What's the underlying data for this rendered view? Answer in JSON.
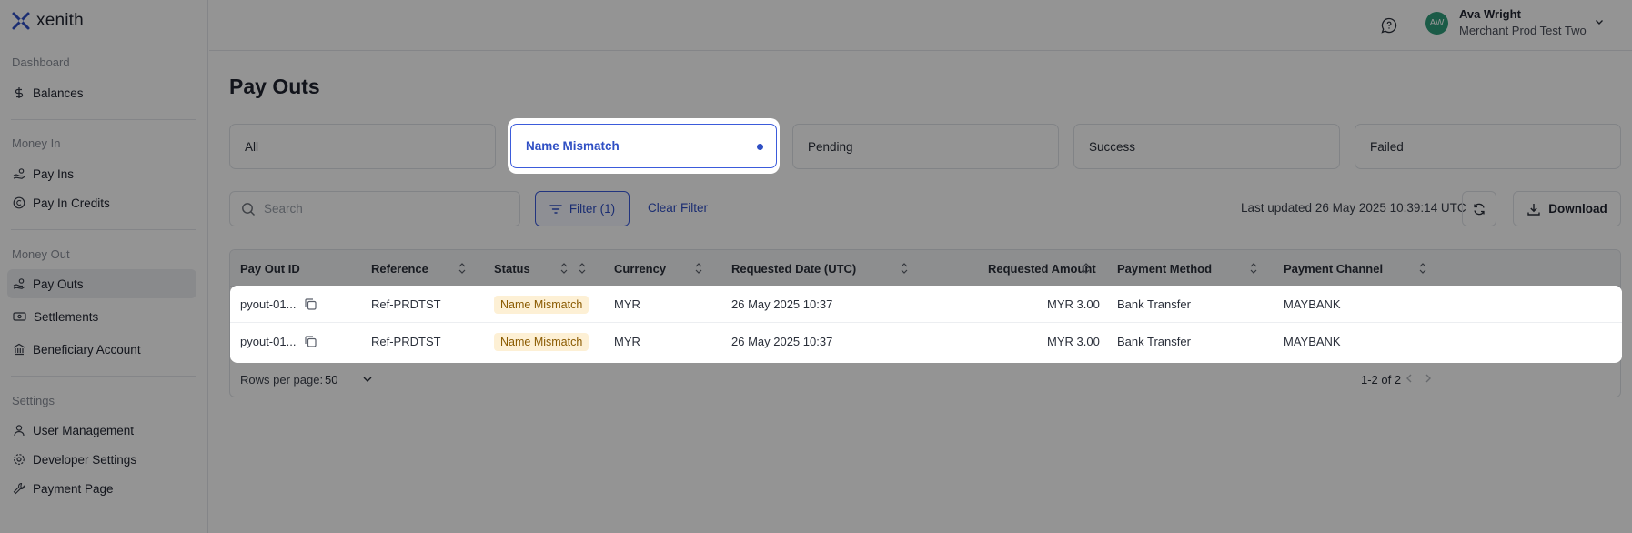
{
  "app": {
    "name": "xenith"
  },
  "sidebar": {
    "sections": [
      {
        "heading": "Dashboard",
        "items": [
          {
            "label": "Balances",
            "icon": "dollar-icon"
          }
        ]
      },
      {
        "heading": "Money In",
        "items": [
          {
            "label": "Pay Ins",
            "icon": "hand-coins-icon"
          },
          {
            "label": "Pay In Credits",
            "icon": "coin-icon"
          }
        ]
      },
      {
        "heading": "Money Out",
        "items": [
          {
            "label": "Pay Outs",
            "icon": "hand-coins-icon"
          },
          {
            "label": "Settlements",
            "icon": "banknote-icon"
          },
          {
            "label": "Beneficiary Account",
            "icon": "bank-icon"
          }
        ]
      },
      {
        "heading": "Settings",
        "items": [
          {
            "label": "User Management",
            "icon": "user-icon"
          },
          {
            "label": "Developer Settings",
            "icon": "gear-icon"
          },
          {
            "label": "Payment Page",
            "icon": "wrench-icon"
          }
        ]
      }
    ],
    "active": "Pay Outs"
  },
  "header": {
    "user_initials": "AW",
    "user_name": "Ava Wright",
    "org_name": "Merchant Prod Test Two"
  },
  "page": {
    "title": "Pay Outs"
  },
  "tabs": [
    {
      "label": "All"
    },
    {
      "label": "Name Mismatch"
    },
    {
      "label": "Pending"
    },
    {
      "label": "Success"
    },
    {
      "label": "Failed"
    }
  ],
  "selected_tab": "Name Mismatch",
  "toolbar": {
    "search_placeholder": "Search",
    "filter_label": "Filter (1)",
    "clear_filter_label": "Clear Filter",
    "last_updated": "Last updated 26 May 2025 10:39:14 UTC",
    "download_label": "Download"
  },
  "table": {
    "columns": [
      "Pay Out ID",
      "Reference",
      "Status",
      "Currency",
      "Requested Date (UTC)",
      "Requested Amount",
      "Payment Method",
      "Payment Channel"
    ],
    "rows": [
      {
        "id": "pyout-01...",
        "reference": "Ref-PRDTST",
        "status": "Name Mismatch",
        "currency": "MYR",
        "date": "26 May 2025 10:37",
        "amount": "MYR 3.00",
        "method": "Bank Transfer",
        "channel": "MAYBANK"
      },
      {
        "id": "pyout-01...",
        "reference": "Ref-PRDTST",
        "status": "Name Mismatch",
        "currency": "MYR",
        "date": "26 May 2025 10:37",
        "amount": "MYR 3.00",
        "method": "Bank Transfer",
        "channel": "MAYBANK"
      }
    ],
    "rows_per_page_label": "Rows per page:",
    "rows_per_page": "50",
    "range": "1-2 of 2"
  },
  "colors": {
    "accent": "#2f4fc4",
    "avatar": "#2f9e7b",
    "badge_bg": "#fdf0d5",
    "badge_text": "#8a5a00"
  }
}
